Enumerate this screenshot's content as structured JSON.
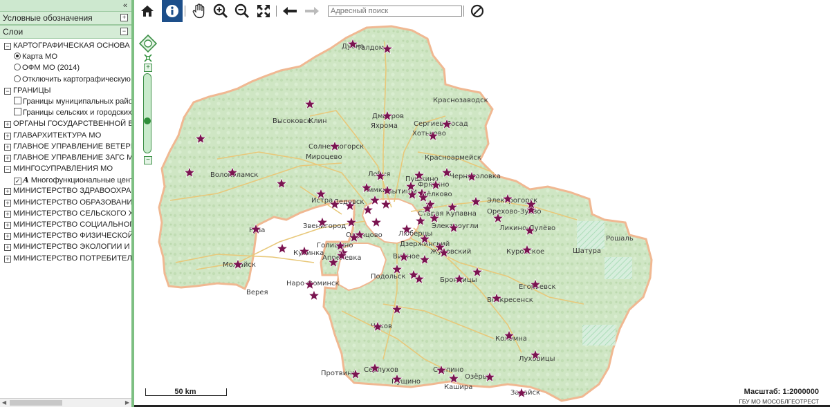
{
  "sidebar": {
    "collapse_glyph": "«",
    "legend_header": "Условные обозначения",
    "layers_header": "Слои",
    "tree": [
      {
        "kind": "group",
        "state": "−",
        "label": "КАРТОГРАФИЧЕСКАЯ ОСНОВА"
      },
      {
        "kind": "radio",
        "checked": true,
        "label": "Карта МО"
      },
      {
        "kind": "radio",
        "checked": false,
        "label": "ОФМ МО (2014)"
      },
      {
        "kind": "radio",
        "checked": false,
        "label": "Отключить картографическую основу"
      },
      {
        "kind": "group",
        "state": "−",
        "label": "ГРАНИЦЫ"
      },
      {
        "kind": "check",
        "checked": false,
        "label": "Границы муниципальных районов и городских округов"
      },
      {
        "kind": "check",
        "checked": false,
        "label": "Границы сельских и городских поселений"
      },
      {
        "kind": "group",
        "state": "+",
        "label": "ОРГАНЫ ГОСУДАРСТВЕННОЙ ВЛАСТИ МО"
      },
      {
        "kind": "group",
        "state": "+",
        "label": "ГЛАВАРХИТЕКТУРА МО"
      },
      {
        "kind": "group",
        "state": "+",
        "label": "ГЛАВНОЕ УПРАВЛЕНИЕ ВЕТЕРИНАРИИ МО"
      },
      {
        "kind": "group",
        "state": "+",
        "label": "ГЛАВНОЕ УПРАВЛЕНИЕ ЗАГС МО"
      },
      {
        "kind": "group",
        "state": "−",
        "label": "МИНГОСУПРАВЛЕНИЯ МО"
      },
      {
        "kind": "check",
        "checked": true,
        "label": "Многофункциональные центры",
        "glyph": "A"
      },
      {
        "kind": "group",
        "state": "+",
        "label": "МИНИСТЕРСТВО ЗДРАВООХРАНЕНИЯ МО"
      },
      {
        "kind": "group",
        "state": "+",
        "label": "МИНИСТЕРСТВО ОБРАЗОВАНИЯ МО"
      },
      {
        "kind": "group",
        "state": "+",
        "label": "МИНИСТЕРСТВО СЕЛЬСКОГО ХОЗЯЙСТВА МО"
      },
      {
        "kind": "group",
        "state": "+",
        "label": "МИНИСТЕРСТВО СОЦИАЛЬНОГО РАЗВИТИЯ МО"
      },
      {
        "kind": "group",
        "state": "+",
        "label": "МИНИСТЕРСТВО ФИЗИЧЕСКОЙ КУЛЬТУРЫ МО"
      },
      {
        "kind": "group",
        "state": "+",
        "label": "МИНИСТЕРСТВО ЭКОЛОГИИ И ПРИРОДОПОЛЬЗОВАНИЯ МО"
      },
      {
        "kind": "group",
        "state": "+",
        "label": "МИНИСТЕРСТВО ПОТРЕБИТЕЛЬСКОГО РЫНКА МО"
      }
    ]
  },
  "toolbar": {
    "address_placeholder": "Адресный поиск",
    "tools": [
      "home-icon",
      "info-icon",
      "pan-icon",
      "zoom-in-icon",
      "zoom-out-icon",
      "full-extent-icon",
      "back-arrow-icon",
      "forward-arrow-icon",
      "clear-icon"
    ]
  },
  "map": {
    "scale_label": "50 km",
    "scale_text": "Масштаб: 1:2000000",
    "credit": "ГБУ МО МОСОБЛГЕОТРЕСТ",
    "colors": {
      "land": "#cfe6c4",
      "boundary": "#f0b892",
      "marker": "#7a1450",
      "road": "#e8c87a"
    },
    "towns": [
      {
        "name": "Дубна"
      },
      {
        "name": "Талдом"
      },
      {
        "name": "Дмитров"
      },
      {
        "name": "Яхрома"
      },
      {
        "name": "Красноармейск"
      },
      {
        "name": "Сергиев Посад"
      },
      {
        "name": "Хотьково"
      },
      {
        "name": "Краснозаводск"
      },
      {
        "name": "Высоковск"
      },
      {
        "name": "Клин"
      },
      {
        "name": "Солнечногорск"
      },
      {
        "name": "Мироцево"
      },
      {
        "name": "Волоколамск"
      },
      {
        "name": "Лобня"
      },
      {
        "name": "Химки"
      },
      {
        "name": "Мытищи"
      },
      {
        "name": "Пушкино"
      },
      {
        "name": "Фрязино"
      },
      {
        "name": "Щёлково"
      },
      {
        "name": "Черноголовка"
      },
      {
        "name": "Истра"
      },
      {
        "name": "Дедовск"
      },
      {
        "name": "Электрогорск"
      },
      {
        "name": "Орехово-Зуево"
      },
      {
        "name": "Ликино-Дулёво"
      },
      {
        "name": "Звенигород"
      },
      {
        "name": "Старая Купавна"
      },
      {
        "name": "Электроугли"
      },
      {
        "name": "Руза"
      },
      {
        "name": "Одинцово"
      },
      {
        "name": "Люберцы"
      },
      {
        "name": "Дзержинский"
      },
      {
        "name": "Голицыно"
      },
      {
        "name": "Кубинка"
      },
      {
        "name": "Апрелевка"
      },
      {
        "name": "Видное"
      },
      {
        "name": "Жуковский"
      },
      {
        "name": "Куровское"
      },
      {
        "name": "Шатура"
      },
      {
        "name": "Рошаль"
      },
      {
        "name": "Можайск"
      },
      {
        "name": "Верея"
      },
      {
        "name": "Наро-Фоминск"
      },
      {
        "name": "Подольск"
      },
      {
        "name": "Бронницы"
      },
      {
        "name": "Егорьевск"
      },
      {
        "name": "Воскресенск"
      },
      {
        "name": "Чехов"
      },
      {
        "name": "Коломна"
      },
      {
        "name": "Луховицы"
      },
      {
        "name": "Протвино"
      },
      {
        "name": "Серпухов"
      },
      {
        "name": "Ступино"
      },
      {
        "name": "Пущино"
      },
      {
        "name": "Озёры"
      },
      {
        "name": "Кашира"
      },
      {
        "name": "Зарайск"
      }
    ],
    "marker_count": 80
  }
}
